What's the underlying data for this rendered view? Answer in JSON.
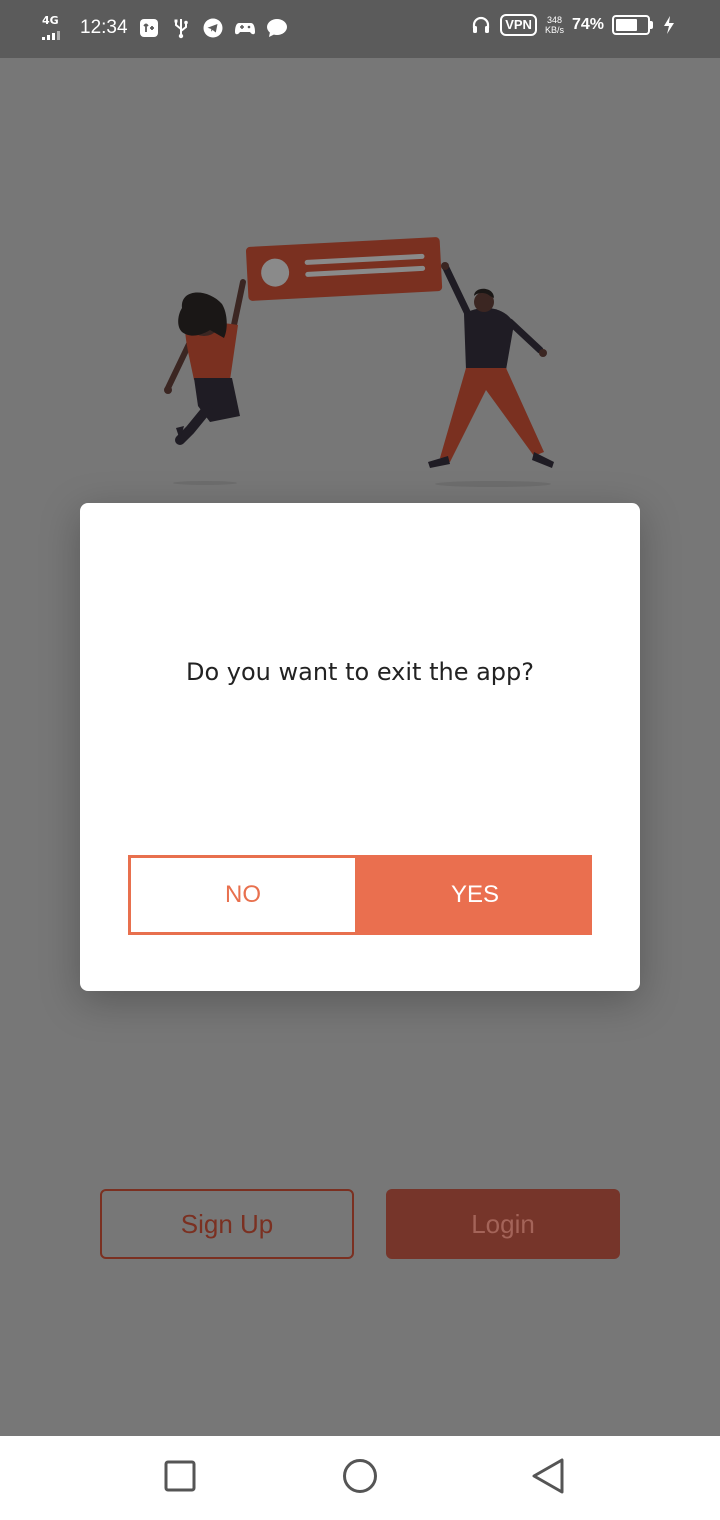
{
  "status_bar": {
    "network": "4G",
    "time": "12:34",
    "vpn": "VPN",
    "speed_value": "348",
    "speed_unit": "KB/s",
    "battery_percent": "74%",
    "battery_level": 0.74
  },
  "dialog": {
    "message": "Do you want to exit the app?",
    "no_label": "NO",
    "yes_label": "YES"
  },
  "background_buttons": {
    "signup_label": "Sign Up",
    "login_label": "Login"
  },
  "navigation": {
    "recents_icon": "square-icon",
    "home_icon": "circle-icon",
    "back_icon": "triangle-back-icon"
  },
  "colors": {
    "accent": "#ea6f4f",
    "scrim_background": "#777777",
    "login_dimmed": "#76352a"
  }
}
